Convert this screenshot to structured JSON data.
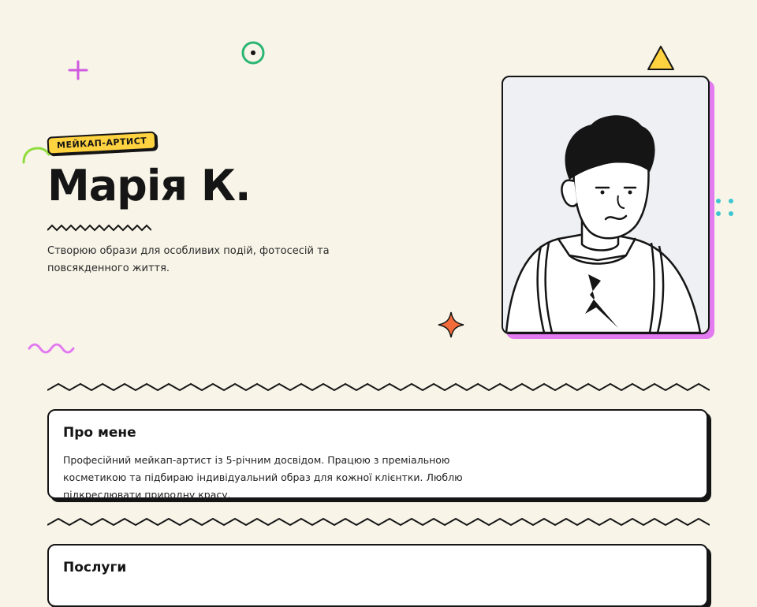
{
  "hero": {
    "badge": "МЕЙКАП-АРТИСТ",
    "name": "Марія К.",
    "description": "Створюю образи для особливих подій, фотосесій та повсякденного життя."
  },
  "about": {
    "title": "Про мене",
    "text": "Професійний мейкап-артист із 5-річним досвідом. Працюю з преміальною косметикою та підбираю індивідуальний образ для кожної клієнтки. Люблю підкреслювати природну красу."
  },
  "services": {
    "title": "Послуги"
  },
  "colors": {
    "background": "#f8f4e8",
    "accent_yellow": "#ffd23f",
    "accent_pink": "#e27af0",
    "accent_green": "#2bb673",
    "accent_orange": "#f26b3a",
    "accent_teal": "#3ec6d0",
    "ink": "#151515"
  },
  "icons": [
    "plus-icon",
    "ring-icon",
    "triangle-icon",
    "arc-icon",
    "dots-icon",
    "sparkle-icon",
    "squiggle-icon"
  ]
}
